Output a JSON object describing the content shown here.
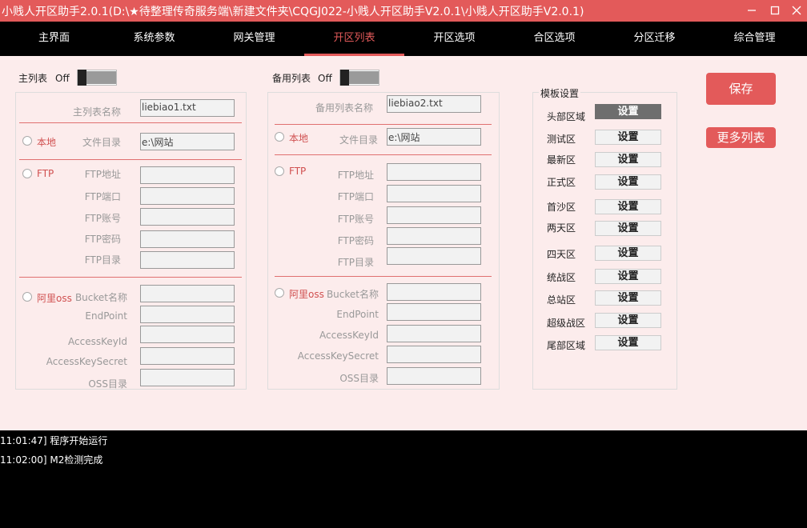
{
  "window": {
    "title": "小贱人开区助手2.0.1(D:\\★待整理传奇服务端\\新建文件夹\\CQGJ022-小贱人开区助手V2.0.1\\小贱人开区助手V2.0.1)"
  },
  "nav": {
    "tabs": [
      "主界面",
      "系统参数",
      "网关管理",
      "开区列表",
      "开区选项",
      "合区选项",
      "分区迁移",
      "综合管理"
    ],
    "active_index": 3
  },
  "main_list": {
    "header": "主列表",
    "toggle_label": "Off",
    "name_label": "主列表名称",
    "name_value": "liebiao1.txt",
    "local_label": "本地",
    "dir_label": "文件目录",
    "dir_value": "e:\\网站",
    "ftp_label": "FTP",
    "ftp_addr_label": "FTP地址",
    "ftp_port_label": "FTP端口",
    "ftp_user_label": "FTP账号",
    "ftp_pass_label": "FTP密码",
    "ftp_dir_label": "FTP目录",
    "oss_label": "阿里oss",
    "bucket_label": "Bucket名称",
    "endpoint_label": "EndPoint",
    "keyid_label": "AccessKeyId",
    "keysecret_label": "AccessKeySecret",
    "ossdir_label": "OSS目录"
  },
  "backup_list": {
    "header": "备用列表",
    "toggle_label": "Off",
    "name_label": "备用列表名称",
    "name_value": "liebiao2.txt",
    "local_label": "本地",
    "dir_label": "文件目录",
    "dir_value": "e:\\网站",
    "ftp_label": "FTP",
    "ftp_addr_label": "FTP地址",
    "ftp_port_label": "FTP端口",
    "ftp_user_label": "FTP账号",
    "ftp_pass_label": "FTP密码",
    "ftp_dir_label": "FTP目录",
    "oss_label": "阿里oss",
    "bucket_label": "Bucket名称",
    "endpoint_label": "EndPoint",
    "keyid_label": "AccessKeyId",
    "keysecret_label": "AccessKeySecret",
    "ossdir_label": "OSS目录"
  },
  "template": {
    "header": "模板设置",
    "button_label": "设置",
    "items": [
      "头部区域",
      "测试区",
      "最新区",
      "正式区",
      "首沙区",
      "两天区",
      "四天区",
      "统战区",
      "总站区",
      "超级战区",
      "尾部区域"
    ],
    "active_index": 0
  },
  "actions": {
    "save_label": "保存",
    "more_label": "更多列表"
  },
  "log": {
    "lines": [
      "11:01:47] 程序开始运行",
      "11:02:00] M2检测完成"
    ]
  }
}
